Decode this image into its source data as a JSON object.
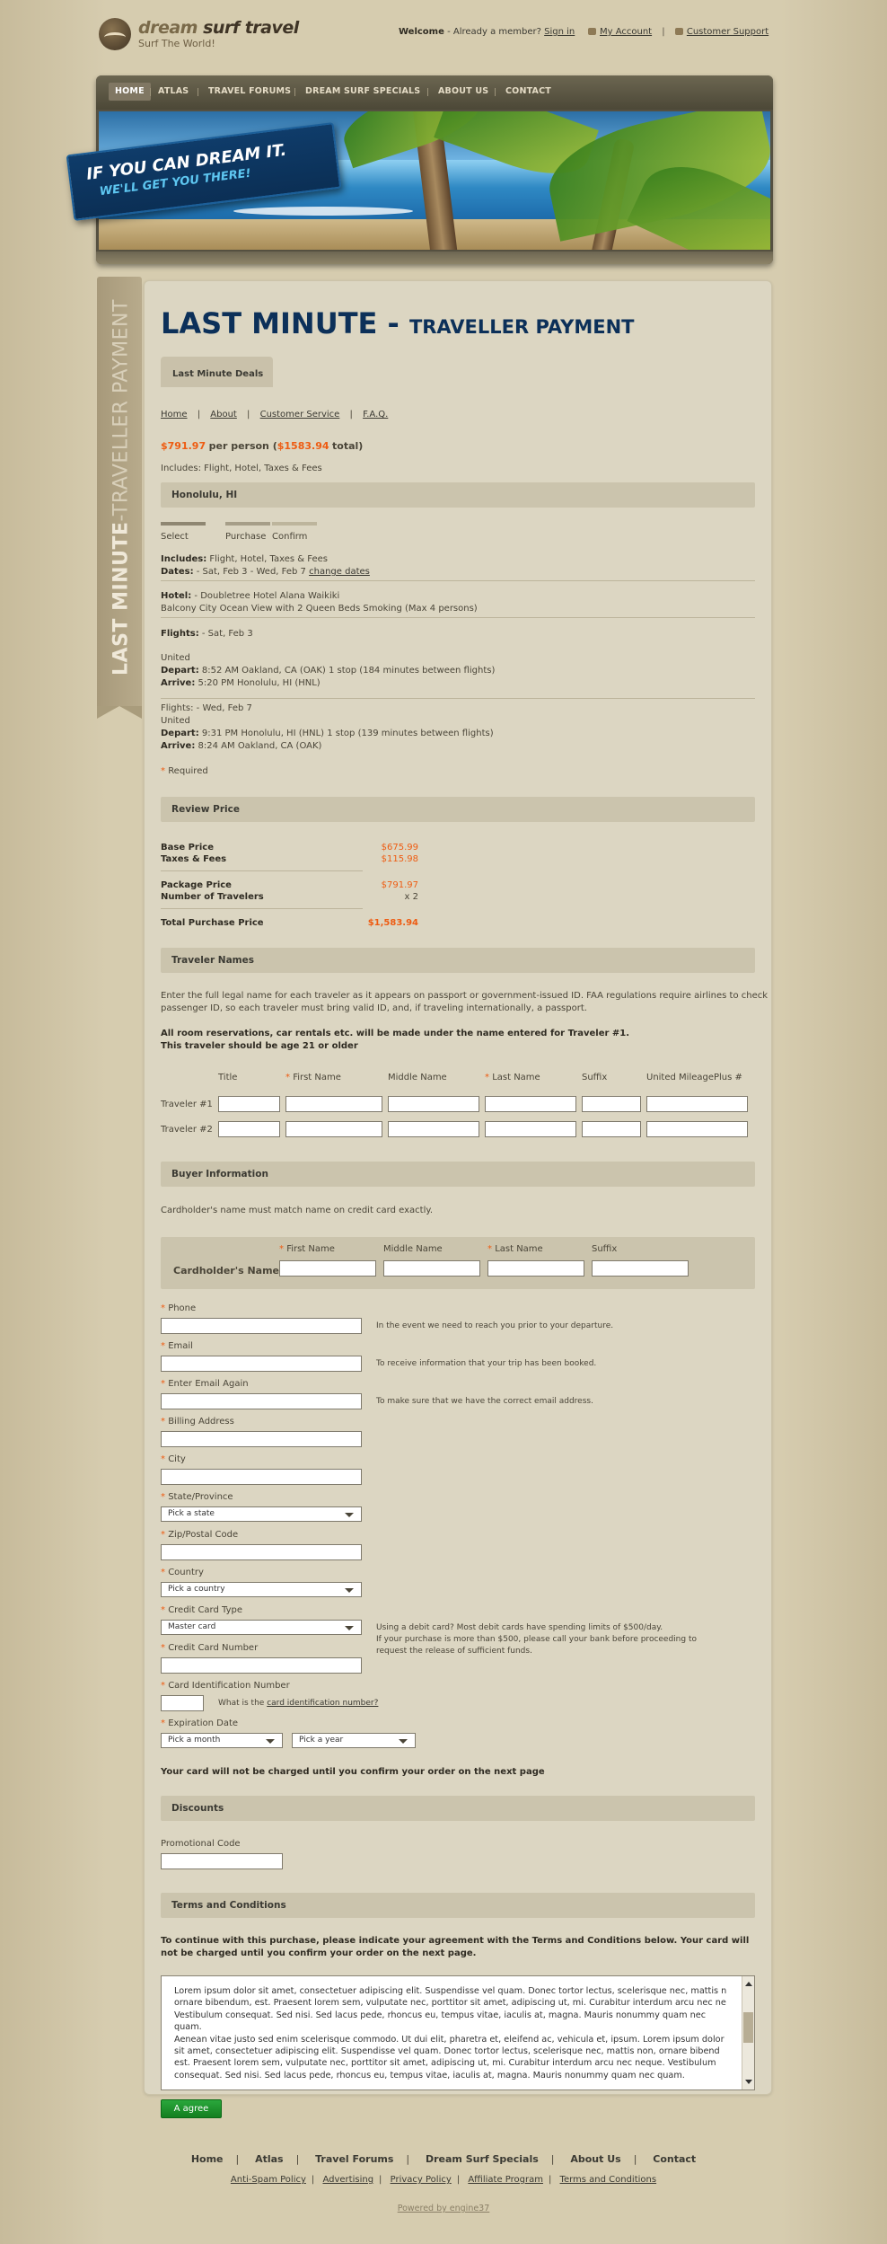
{
  "brand": {
    "name_a": "dream",
    "name_b": "surf travel",
    "slogan": "Surf The World!"
  },
  "topbar": {
    "welcome": "Welcome",
    "member_text": "- Already a member?",
    "sign_in": "Sign in",
    "my_account": "My Account",
    "support": "Customer Support"
  },
  "nav": [
    {
      "label": "HOME"
    },
    {
      "label": "ATLAS"
    },
    {
      "label": "TRAVEL FORUMS"
    },
    {
      "label": "DREAM SURF SPECIALS"
    },
    {
      "label": "ABOUT US"
    },
    {
      "label": "CONTACT"
    }
  ],
  "banner": {
    "line1": "IF YOU CAN DREAM IT.",
    "line2": "WE'LL GET YOU THERE!"
  },
  "ribbon": {
    "bold": "LAST MINUTE",
    "rest": "-TRAVELLER PAYMENT"
  },
  "page": {
    "title_main": "LAST MINUTE - ",
    "title_sub": "TRAVELLER PAYMENT",
    "tab": "Last Minute Deals"
  },
  "breadcrumbs": [
    "Home",
    "About",
    "Customer Service",
    "F.A.Q."
  ],
  "summary": {
    "per_person": "$791.97",
    "per_person_label": "per person (",
    "total": "$1583.94",
    "total_label": "total)",
    "includes": "Includes: Flight, Hotel, Taxes & Fees"
  },
  "destination": "Honolulu, HI",
  "steps": [
    "Select",
    "Purchase",
    "Confirm"
  ],
  "details": {
    "includes_label": "Includes:",
    "includes_value": "Flight, Hotel, Taxes & Fees",
    "dates_label": "Dates:",
    "dates_value": "- Sat, Feb 3 - Wed, Feb 7",
    "change_dates": "change dates",
    "hotel_label": "Hotel:",
    "hotel_value": "- Doubletree Hotel Alana Waikiki",
    "room": "Balcony City Ocean View with 2 Queen Beds Smoking (Max 4 persons)",
    "flights_label": "Flights:",
    "flights_out_date": "- Sat, Feb 3",
    "out_airline": "United",
    "depart_label": "Depart:",
    "out_depart": "8:52 AM Oakland, CA (OAK) 1 stop (184 minutes between flights)",
    "arrive_label": "Arrive:",
    "out_arrive": "5:20 PM Honolulu, HI (HNL)",
    "ret_flights": "Flights: - Wed, Feb 7",
    "ret_airline": "United",
    "ret_depart": "9:31 PM Honolulu, HI (HNL) 1 stop (139 minutes between flights)",
    "ret_arrive": "8:24 AM Oakland, CA (OAK)",
    "required": "Required"
  },
  "review": {
    "title": "Review Price",
    "base_label": "Base Price",
    "base": "$675.99",
    "taxes_label": "Taxes & Fees",
    "taxes": "$115.98",
    "package_label": "Package Price",
    "package": "$791.97",
    "travelers_label": "Number of Travelers",
    "travelers": "x  2",
    "total_label": "Total Purchase Price",
    "total": "$1,583.94"
  },
  "travelers": {
    "title": "Traveler Names",
    "intro1": "Enter the full legal name for each traveler as it appears on passport or government-issued ID. FAA regulations require airlines to check",
    "intro2": "passenger ID, so each traveler must bring valid ID, and, if traveling internationally, a passport.",
    "bold1": "All room reservations, car rentals etc. will be made under the name entered for Traveler #1.",
    "bold2": "This traveler should be age 21 or older",
    "columns": [
      "Title",
      "First Name",
      "Middle Name",
      "Last Name",
      "Suffix",
      "United MileagePlus #"
    ],
    "rows": [
      "Traveler #1",
      "Traveler #2"
    ]
  },
  "buyer": {
    "title": "Buyer Information",
    "intro": "Cardholder's name must match name on credit card exactly.",
    "cardholder": "Cardholder's Name",
    "columns": [
      "First Name",
      "Middle Name",
      "Last Name",
      "Suffix"
    ],
    "fields": {
      "phone": "Phone",
      "email": "Email",
      "email_again": "Enter Email Again",
      "billing": "Billing Address",
      "city": "City",
      "state": "State/Province",
      "zip": "Zip/Postal Code",
      "country": "Country",
      "cc_type": "Credit Card Type",
      "cc_number": "Credit Card Number",
      "cc_id": "Card Identification Number",
      "expiry": "Expiration Date"
    },
    "state_value": "Pick a state",
    "country_value": "Pick a country",
    "cc_type_value": "Master card",
    "month_value": "Pick a month",
    "year_value": "Pick a year",
    "phone_note": "In the event we need to reach you prior to your departure.",
    "email_note": "To receive information that your trip has been booked.",
    "email2_note": "To make sure that we have the correct email address.",
    "debit1": "Using a debit card? Most debit cards have spending limits of $500/day.",
    "debit2": "If your purchase is more than $500, please call your bank before proceeding to",
    "debit3": "request the release of sufficient funds.",
    "what_is": "What is the",
    "cid_link": "card identification number?",
    "charge_note": "Your card will not be charged until you confirm your order on the next page"
  },
  "discounts": {
    "title": "Discounts",
    "promo": "Promotional Code"
  },
  "terms": {
    "title": "Terms and Conditions",
    "intro1": "To continue with this purchase, please indicate your agreement with the Terms and Conditions below. Your card will",
    "intro2": "not be charged until you confirm your order on the next page.",
    "lines": [
      "Lorem ipsum dolor sit amet, consectetuer adipiscing elit. Suspendisse vel quam. Donec tortor lectus, scelerisque nec, mattis n",
      "ornare bibendum, est. Praesent lorem sem, vulputate nec, porttitor sit amet, adipiscing ut, mi. Curabitur interdum arcu nec ne",
      "Vestibulum consequat. Sed nisi. Sed lacus pede, rhoncus eu, tempus vitae, iaculis at, magna. Mauris nonummy quam nec quam.",
      "Aenean vitae justo sed enim scelerisque commodo. Ut dui elit, pharetra et, eleifend ac, vehicula et, ipsum. Lorem ipsum dolor",
      "sit amet, consectetuer adipiscing elit. Suspendisse vel quam. Donec tortor lectus, scelerisque nec, mattis non, ornare bibend",
      "est. Praesent lorem sem, vulputate nec, porttitor sit amet, adipiscing ut, mi. Curabitur interdum arcu nec neque. Vestibulum",
      "consequat. Sed nisi. Sed lacus pede, rhoncus eu, tempus vitae, iaculis at, magna. Mauris nonummy quam nec quam."
    ],
    "agree": "A agree"
  },
  "footer": {
    "links": [
      "Home",
      "Atlas",
      "Travel Forums",
      "Dream Surf Specials",
      "About Us",
      "Contact"
    ],
    "links2": [
      "Anti-Spam Policy",
      "Advertising",
      "Privacy Policy",
      "Affiliate Program",
      "Terms and Conditions"
    ],
    "powered": "Powered by engine37"
  },
  "colors": {
    "accent": "#ee5c12",
    "title": "#0c3059",
    "button": "#1e8f2c"
  }
}
